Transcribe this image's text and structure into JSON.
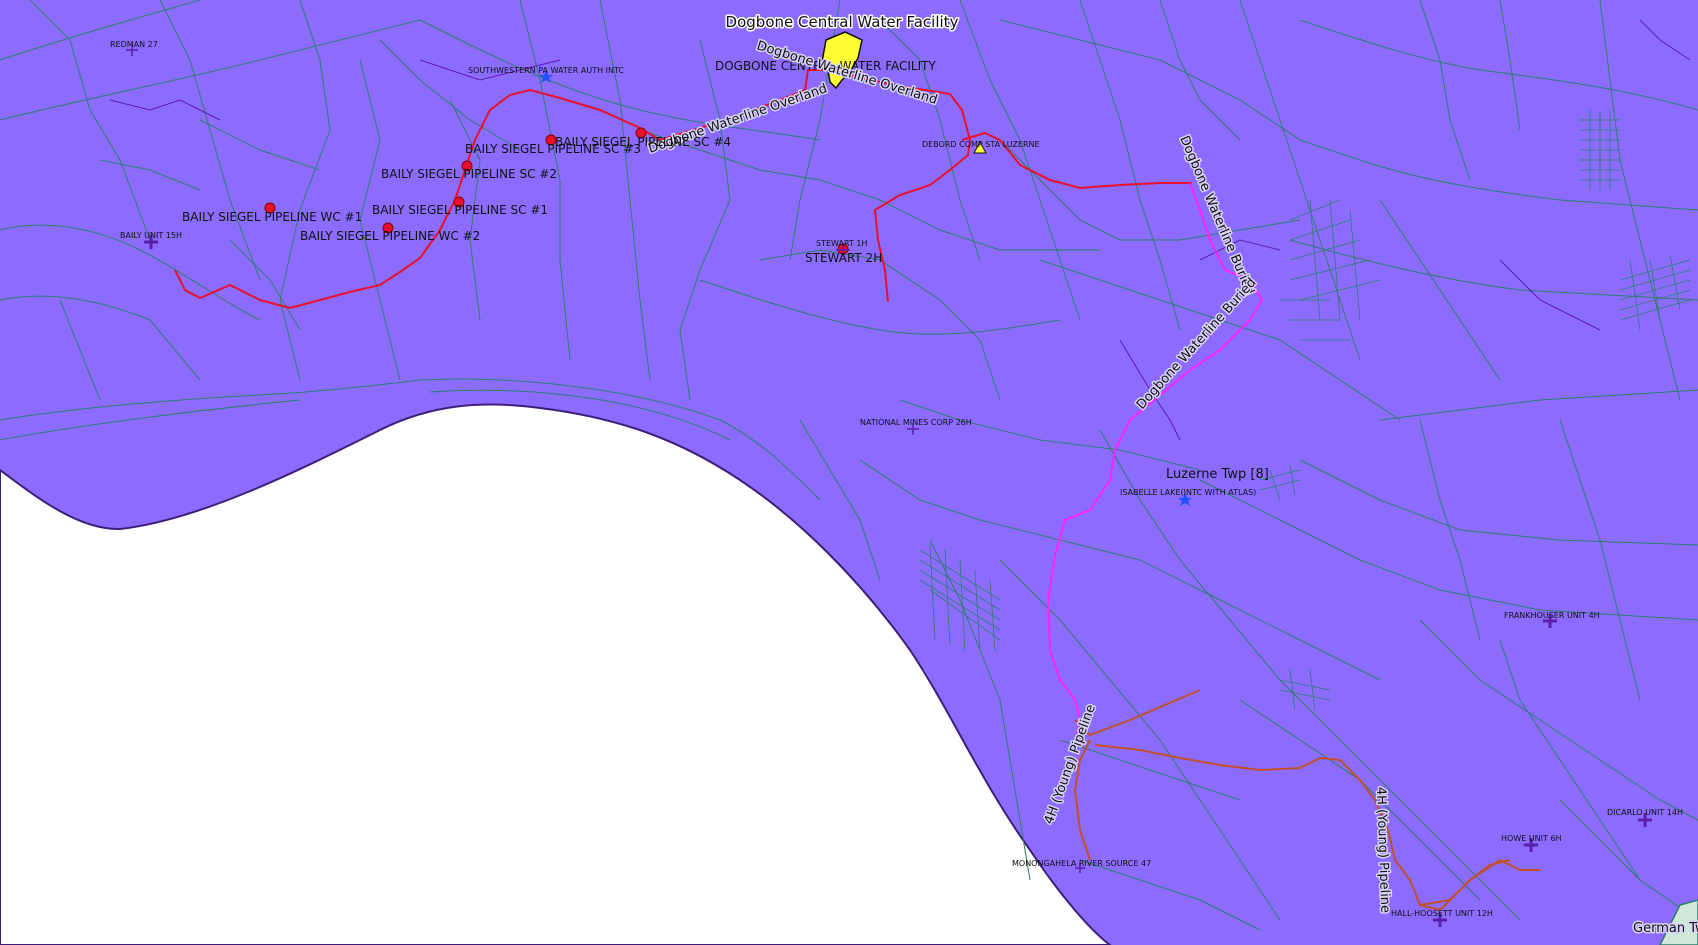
{
  "colors": {
    "land": "#8c6cff",
    "river": "#ffffff",
    "parcel": "#2e7d6a",
    "pipeline_red": "#e8102a",
    "pipeline_magenta": "#ff22ff",
    "pipeline_brown": "#c0502a",
    "facility": "#ffff33",
    "well_purple": "#5a1fa8",
    "well_blue": "#2050ff"
  },
  "labels": {
    "facility_title": "Dogbone Central Water Facility",
    "facility_caps": "DOGBONE CENTRAL WATER FACILITY",
    "waterline_overland_1": "Dogbone Waterline Overland",
    "waterline_overland_2": "Dogbone Waterline Overland",
    "waterline_buried_1": "Dogbone Waterline Buried",
    "waterline_buried_2": "Dogbone Waterline Buried",
    "young_pipeline_1": "4H (Young) Pipeline",
    "young_pipeline_2": "4H (Young) Pipeline",
    "township": "Luzerne Twp [8]",
    "german_twp": "German Tw"
  },
  "pipeline_points": [
    {
      "name": "BAILY SIEGEL PIPELINE WC #1"
    },
    {
      "name": "BAILY SIEGEL PIPELINE WC #2"
    },
    {
      "name": "BAILY SIEGEL PIPELINE SC #1"
    },
    {
      "name": "BAILY SIEGEL PIPELINE SC #2"
    },
    {
      "name": "BAILY SIEGEL PIPELINE SC #3"
    },
    {
      "name": "BAILY SIEGEL PIPELINE SC #4"
    },
    {
      "name": "STEWART 2H"
    }
  ],
  "wells": [
    {
      "name": "REDMAN 27"
    },
    {
      "name": "SOUTHWESTERN PA WATER AUTH INTC"
    },
    {
      "name": "BAILY UNIT 15H"
    },
    {
      "name": "DEBORD COMP STA LUZERNE"
    },
    {
      "name": "STEWART 1H"
    },
    {
      "name": "NATIONAL MINES CORP 26H"
    },
    {
      "name": "ISABELLE LAKE(INTC WITH ATLAS)"
    },
    {
      "name": "FRANKHOUSER UNIT 4H"
    },
    {
      "name": "DICARLO UNIT 14H"
    },
    {
      "name": "HOWE UNIT 6H"
    },
    {
      "name": "MONONGAHELA RIVER SOURCE 47"
    },
    {
      "name": "HALL-HOOSETT UNIT 12H"
    }
  ]
}
